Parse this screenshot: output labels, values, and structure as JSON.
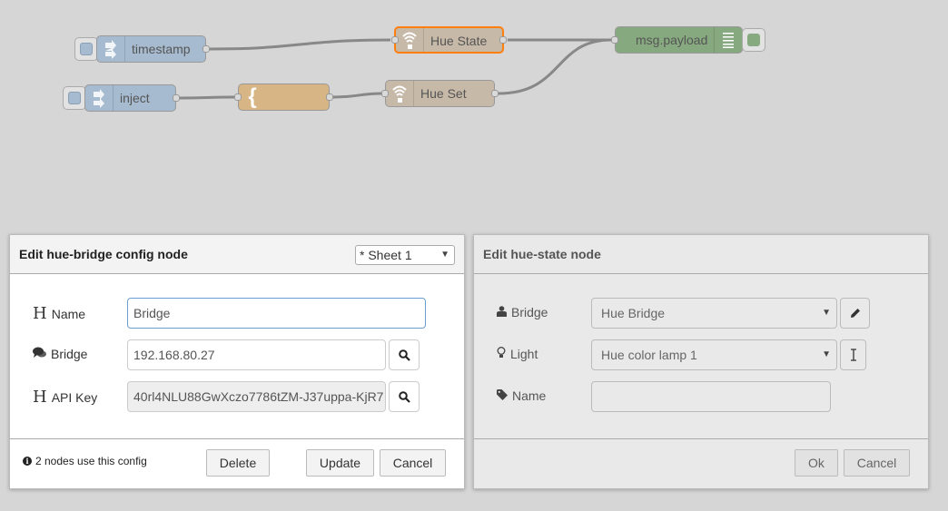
{
  "flow": {
    "nodes": {
      "timestamp": "timestamp",
      "inject": "inject",
      "hue_state": "Hue State",
      "hue_set": "Hue Set",
      "msg_payload": "msg.payload",
      "function_glyph": "{"
    }
  },
  "config_panel": {
    "title": "Edit hue-bridge config node",
    "sheet_select": "* Sheet 1",
    "fields": {
      "name_label": "Name",
      "name_value": "Bridge",
      "bridge_label": "Bridge",
      "bridge_value": "192.168.80.27",
      "api_key_label": "API Key",
      "api_key_value": "40rl4NLU88GwXczo7786tZM-J37uppa-KjR7"
    },
    "footer": {
      "info_text": "2 nodes use this config",
      "delete_label": "Delete",
      "update_label": "Update",
      "cancel_label": "Cancel"
    }
  },
  "state_panel": {
    "title": "Edit hue-state node",
    "fields": {
      "bridge_label": "Bridge",
      "bridge_value": "Hue Bridge",
      "light_label": "Light",
      "light_value": "Hue color lamp 1",
      "name_label": "Name",
      "name_value": ""
    },
    "footer": {
      "ok_label": "Ok",
      "cancel_label": "Cancel"
    }
  },
  "colors": {
    "workspace_bg": "#d6d6d6",
    "inject_node": "#a6bbcf",
    "hue_node": "#c7b9a8",
    "function_node": "#d8b585",
    "debug_node": "#87a980",
    "selected_border": "#ff7f0e"
  },
  "icons": [
    "arrow-in-icon",
    "wifi-icon",
    "brace-icon",
    "list-icon",
    "search-icon",
    "user-icon",
    "comments-icon",
    "lightbulb-icon",
    "tag-icon",
    "pencil-icon",
    "text-cursor-icon",
    "info-icon",
    "header-icon"
  ]
}
